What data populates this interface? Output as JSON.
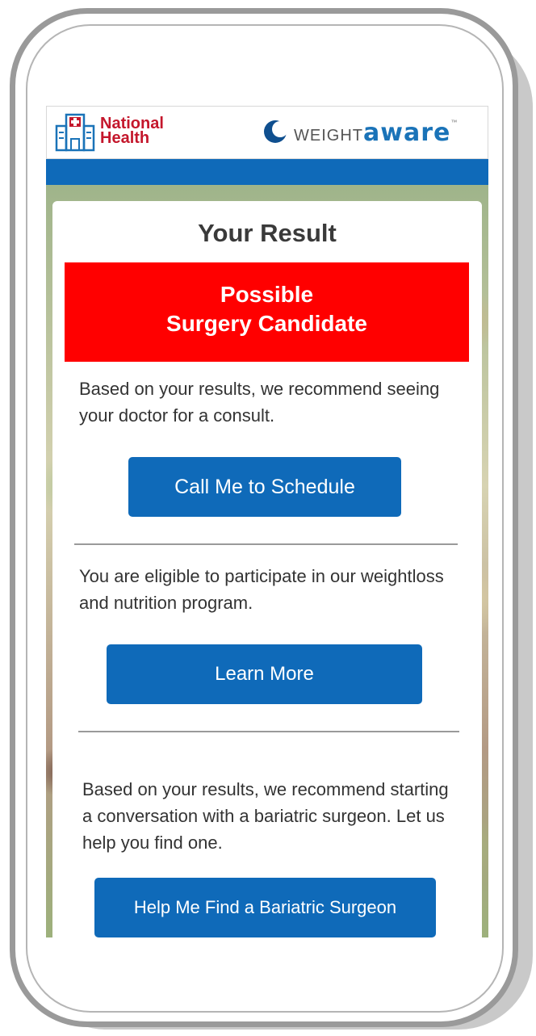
{
  "header": {
    "national_health_line1": "National",
    "national_health_line2": "Health",
    "weightaware_weight": "WEIGHT",
    "weightaware_aware": "aware",
    "weightaware_tm": "™"
  },
  "result": {
    "title": "Your Result",
    "status_line1": "Possible",
    "status_line2": "Surgery Candidate"
  },
  "sections": [
    {
      "text": "Based on your results, we recommend seeing your doctor for a consult.",
      "button_label": "Call Me to Schedule"
    },
    {
      "text": "You are eligible to participate in our weightloss and nutrition program.",
      "button_label": "Learn More"
    },
    {
      "text": "Based on your results, we recommend starting a conversation with a bariatric surgeon. Let us help you find one.",
      "button_label": "Help Me Find a Bariatric Surgeon"
    }
  ],
  "colors": {
    "brand_blue": "#0f6ab9",
    "alert_red": "#ff0000",
    "national_health_red": "#c4172c"
  }
}
